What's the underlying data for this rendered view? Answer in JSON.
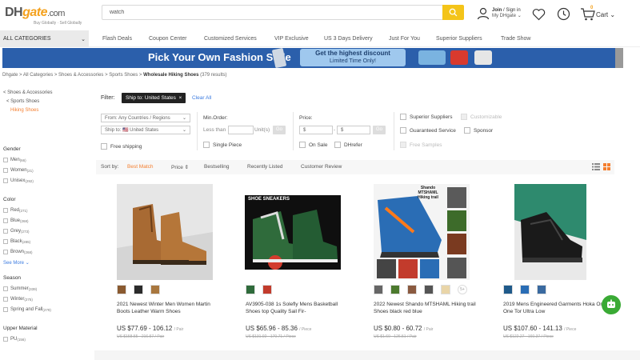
{
  "header": {
    "logo": {
      "dh": "DH",
      "gate": "gate",
      "com": ".com"
    },
    "tagline": "Buy Globally · Sell Globally",
    "search": {
      "value": "watch",
      "placeholder": "watch"
    },
    "account": {
      "join": "Join",
      "sign_in": "/ Sign in",
      "my": "My DHgate"
    },
    "cart": {
      "label": "Cart",
      "count": "0"
    }
  },
  "nav": {
    "all_categories": "ALL CATEGORIES",
    "items": [
      "Flash Deals",
      "Coupon Center",
      "Customized Services",
      "VIP Exclusive",
      "US 3 Days Delivery",
      "Just For You",
      "Superior Suppliers",
      "Trade Show"
    ]
  },
  "banner": {
    "headline": "Pick Your Own Fashion Style",
    "promo_line1": "Get the highest discount",
    "promo_line2": "Limited Time Only!"
  },
  "breadcrumb": {
    "path": "Dhgate > All Categories > Shoes & Accessories > Sports Shoes > ",
    "current": "Wholesale Hiking Shoes",
    "count": " (379 results)"
  },
  "sidebar": {
    "links": [
      "< Shoes & Accessories",
      "< Sports Shoes",
      "Hiking Shoes"
    ],
    "gender": {
      "title": "Gender",
      "options": [
        {
          "label": "Men",
          "count": "(66)"
        },
        {
          "label": "Women",
          "count": "(21)"
        },
        {
          "label": "Unisex",
          "count": "(292)"
        }
      ]
    },
    "color": {
      "title": "Color",
      "options": [
        {
          "label": "Red",
          "count": "(271)"
        },
        {
          "label": "Blue",
          "count": "(268)"
        },
        {
          "label": "Grey",
          "count": "(273)"
        },
        {
          "label": "Black",
          "count": "(285)"
        },
        {
          "label": "Brown",
          "count": "(268)"
        }
      ],
      "see_more": "See More"
    },
    "season": {
      "title": "Season",
      "options": [
        {
          "label": "Summer",
          "count": "(339)"
        },
        {
          "label": "Winter",
          "count": "(275)"
        },
        {
          "label": "Spring and Fall",
          "count": "(279)"
        }
      ]
    },
    "upper_material": {
      "title": "Upper Material",
      "options": [
        {
          "label": "PU",
          "count": "(156)"
        }
      ]
    }
  },
  "filters": {
    "label": "Filter:",
    "chip": "Ship to: United States",
    "chip_close": "×",
    "clear_all": "Clear All",
    "from": "From: Any Countries / Regions",
    "ship_to": "Ship to: 🇺🇸 United States",
    "free_shipping": "Free shipping",
    "min_order": {
      "title": "Min.Order:",
      "less_than": "Less than",
      "unit": "Unit(s)",
      "go": "Go",
      "single_piece": "Single Piece"
    },
    "price": {
      "title": "Price:",
      "from": "$",
      "to": "$",
      "go": "Go",
      "on_sale": "On Sale",
      "dhrefer": "DHrefer"
    },
    "options": {
      "superior_suppliers": "Superior Suppliers",
      "customizable": "Customizable",
      "guaranteed_service": "Guaranteed Service",
      "sponsor": "Sponsor",
      "free_samples": "Free Samples"
    }
  },
  "sort": {
    "label": "Sort by:",
    "options": [
      "Best Match",
      "Price ⇕",
      "Bestselling",
      "Recently Listed",
      "Customer Review"
    ]
  },
  "products": [
    {
      "title": "2021 Newest Winter Men Women Martin Boots Leather Warm Shoes",
      "price": "US $77.69 - 106.12",
      "unit": "/ Pair",
      "old_price": "US $158.55 - 216.57 / Pair",
      "thumbs": 3
    },
    {
      "title": "AV3905-038 1s Solefly Mens Basketball Shoes top Quality Sail Fir-",
      "price": "US $65.96 - 85.36",
      "unit": "/ Piece",
      "old_price": "US $131.92 - 170.71 / Piece",
      "thumbs": 2,
      "img_text": "SHOE SNEAKERS"
    },
    {
      "title": "2022 Newest Shando MTSHAML Hiking trail Shoes black red blue",
      "price": "US $0.80 - 60.72",
      "unit": "/ Pair",
      "old_price": "US $1.60 - 126.51 / Pair",
      "thumbs": 5,
      "more": "5+",
      "img_text": "Shando MTSHAML Hiking trail"
    },
    {
      "title": "2019 Mens Engineered Garments Hoka One One Tor Ultra Low",
      "price": "US $107.60 - 141.13",
      "unit": "/ Piece",
      "old_price": "US $122.27 - 160.37 / Piece",
      "thumbs": 3
    }
  ],
  "colors": {
    "accent": "#f4c419",
    "orange": "#f47e2e",
    "link": "#3b7be0",
    "banner": "#2b5fab",
    "chat": "#3aaa35"
  }
}
